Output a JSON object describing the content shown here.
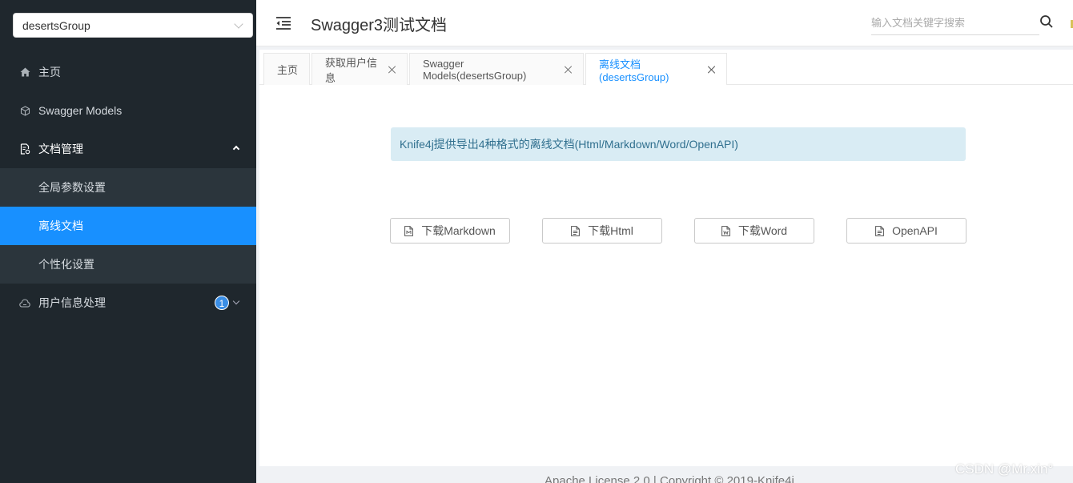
{
  "sidebar": {
    "group_select": "desertsGroup",
    "items": [
      {
        "label": "主页",
        "icon": "home-icon"
      },
      {
        "label": "Swagger Models",
        "icon": "cube-icon"
      },
      {
        "label": "文档管理",
        "icon": "doc-manage-icon"
      },
      {
        "label": "用户信息处理",
        "icon": "cloud-icon",
        "badge": "1"
      }
    ],
    "doc_sub_items": [
      {
        "label": "全局参数设置"
      },
      {
        "label": "离线文档"
      },
      {
        "label": "个性化设置"
      }
    ]
  },
  "header": {
    "title": "Swagger3测试文档",
    "search_placeholder": "输入文档关键字搜索"
  },
  "tabs": [
    {
      "label": "主页"
    },
    {
      "label": "获取用户信息"
    },
    {
      "label": "Swagger Models(desertsGroup)"
    },
    {
      "label": "离线文档(desertsGroup)"
    }
  ],
  "content": {
    "alert": "Knife4j提供导出4种格式的离线文档(Html/Markdown/Word/OpenAPI)",
    "buttons": [
      {
        "label": "下载Markdown"
      },
      {
        "label": "下载Html"
      },
      {
        "label": "下载Word"
      },
      {
        "label": "OpenAPI"
      }
    ]
  },
  "footer": {
    "text": "Apache License 2.0 | Copyright © 2019-Knife4j"
  },
  "watermark": "CSDN @Mr.xin°",
  "colors": {
    "sidebar_bg": "#1f272d",
    "submenu_bg": "#2b353c",
    "accent": "#1890ff",
    "alert_bg": "#d9ecf4",
    "alert_text": "#31708f"
  }
}
